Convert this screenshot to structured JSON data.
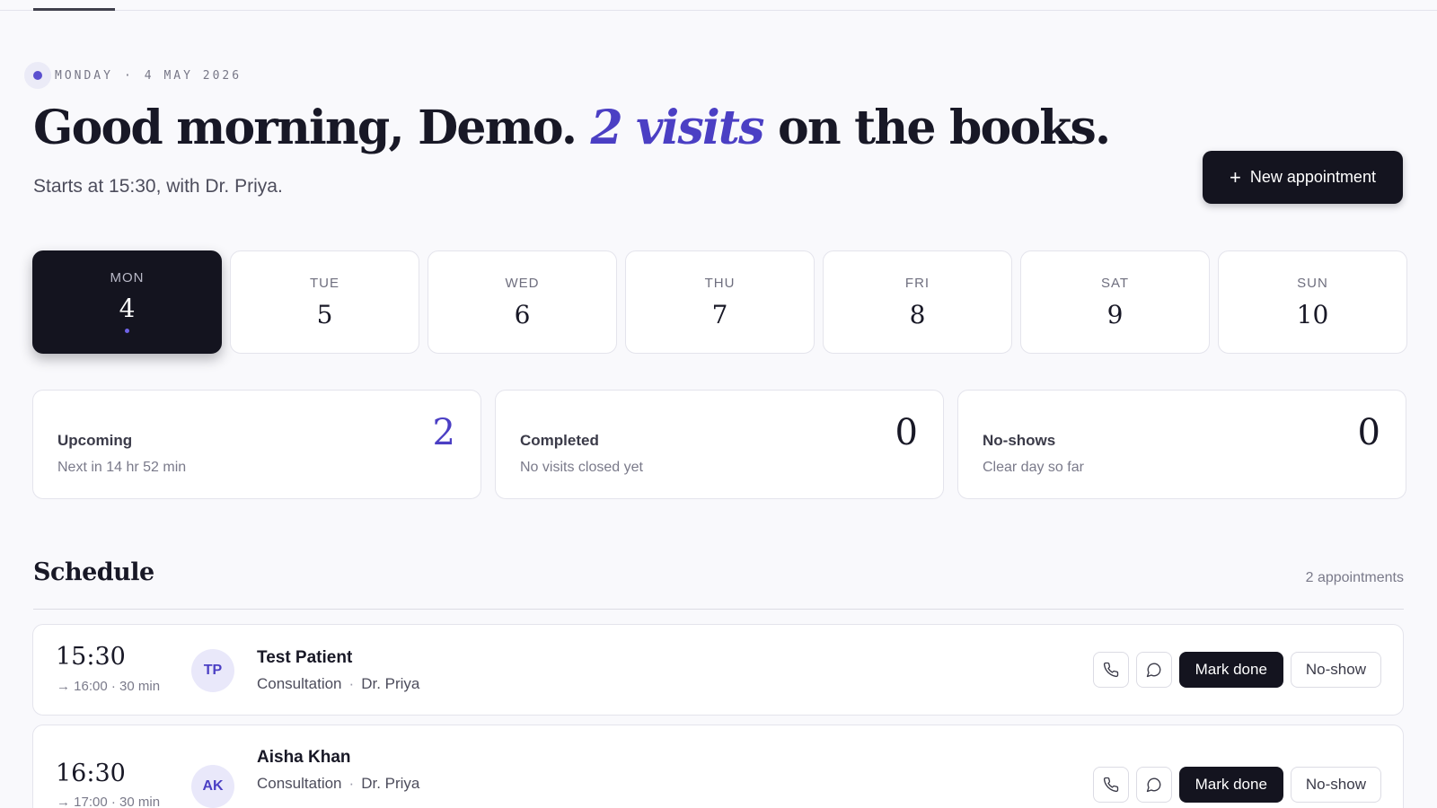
{
  "date": {
    "weekday": "MONDAY",
    "sep": "·",
    "full_date": "4 MAY 2026"
  },
  "greeting": {
    "before": "Good morning, Demo. ",
    "accent": "2 visits",
    "after": " on the books."
  },
  "subline": "Starts at 15:30, with Dr. Priya.",
  "new_appointment": {
    "icon": "plus-icon",
    "plus": "+",
    "label": "New appointment"
  },
  "days": [
    {
      "name": "MON",
      "num": "4"
    },
    {
      "name": "TUE",
      "num": "5"
    },
    {
      "name": "WED",
      "num": "6"
    },
    {
      "name": "THU",
      "num": "7"
    },
    {
      "name": "FRI",
      "num": "8"
    },
    {
      "name": "SAT",
      "num": "9"
    },
    {
      "name": "SUN",
      "num": "10"
    }
  ],
  "selected_day": "MON",
  "stats": [
    {
      "label": "Upcoming",
      "sub": "Next in 14 hr 52 min",
      "value": "2",
      "accent": true
    },
    {
      "label": "Completed",
      "sub": "No visits closed yet",
      "value": "0",
      "accent": false
    },
    {
      "label": "No-shows",
      "sub": "Clear day so far",
      "value": "0",
      "accent": false
    }
  ],
  "schedule": {
    "title": "Schedule",
    "count": "2 appointments",
    "appointments": [
      {
        "time": "15:30",
        "range": "→ 16:00 · 30 min",
        "initials": "TP",
        "name": "Test Patient",
        "type": "Consultation",
        "sep": "·",
        "doctor": "Dr. Priya",
        "done_label": "Mark done",
        "noshow_label": "No-show"
      },
      {
        "time": "16:30",
        "range": "→ 17:00 · 30 min",
        "initials": "AK",
        "name": "Aisha Khan",
        "type": "Consultation",
        "sep": "·",
        "doctor": "Dr. Priya",
        "done_label": "Mark done",
        "noshow_label": "No-show"
      }
    ]
  },
  "icons": {
    "call": "phone-icon",
    "message": "chat-bubble-icon"
  },
  "colors": {
    "accent": "#4b3fc4",
    "dark": "#14141f",
    "background": "#f9f9fc"
  }
}
